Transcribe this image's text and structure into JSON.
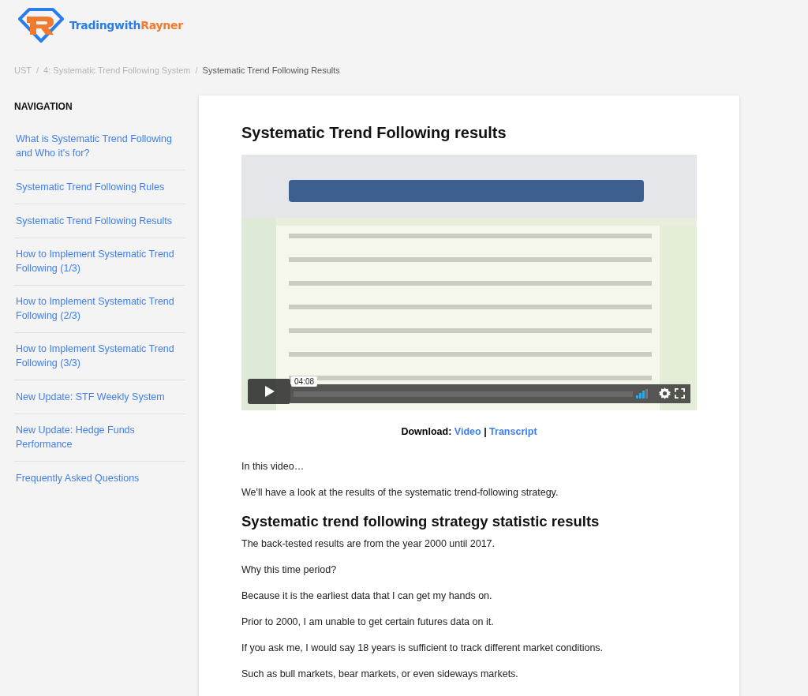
{
  "logo": {
    "primary": "Tradingwith",
    "secondary": "Rayner"
  },
  "breadcrumb_separator": "/",
  "breadcrumb": [
    {
      "label": "UST",
      "current": false
    },
    {
      "label": "4: Systematic Trend Following System",
      "current": false
    },
    {
      "label": "Systematic Trend Following Results",
      "current": true
    }
  ],
  "sidebar": {
    "heading": "NAVIGATION",
    "items": [
      {
        "label": "What is Systematic Trend Following and Who it's for?"
      },
      {
        "label": "Systematic Trend Following Rules"
      },
      {
        "label": "Systematic Trend Following Results"
      },
      {
        "label": "How to Implement Systematic Trend Following (1/3)"
      },
      {
        "label": "How to Implement Systematic Trend Following (2/3)"
      },
      {
        "label": "How to Implement Systematic Trend Following (3/3)"
      },
      {
        "label": "New Update: STF Weekly System"
      },
      {
        "label": "New Update: Hedge Funds Performance"
      },
      {
        "label": "Frequently Asked Questions"
      }
    ]
  },
  "article": {
    "title": "Systematic Trend Following results",
    "video": {
      "kind": "picture",
      "time_tooltip": "04:08"
    },
    "download": {
      "label": "Download:",
      "links": [
        "Video",
        "Transcript"
      ],
      "separator": "|"
    },
    "blocks": [
      {
        "kind": "p",
        "text": "In this video…"
      },
      {
        "kind": "p",
        "text": "We'll have a look at the results of the systematic trend-following strategy."
      },
      {
        "kind": "h2",
        "text": "Systematic trend following strategy statistic results"
      },
      {
        "kind": "p",
        "text": "The back-tested results are from the year 2000 until 2017."
      },
      {
        "kind": "p",
        "text": "Why this time period?"
      },
      {
        "kind": "p",
        "text": "Because it is the earliest data that I can get my hands on."
      },
      {
        "kind": "p",
        "text": "Prior to 2000, I am unable to get certain futures data on it."
      },
      {
        "kind": "p",
        "text": "If you ask me, I would say 18 years is sufficient to track different market conditions."
      },
      {
        "kind": "p",
        "text": "Such as bull markets, bear markets, or even sideways markets."
      }
    ]
  }
}
